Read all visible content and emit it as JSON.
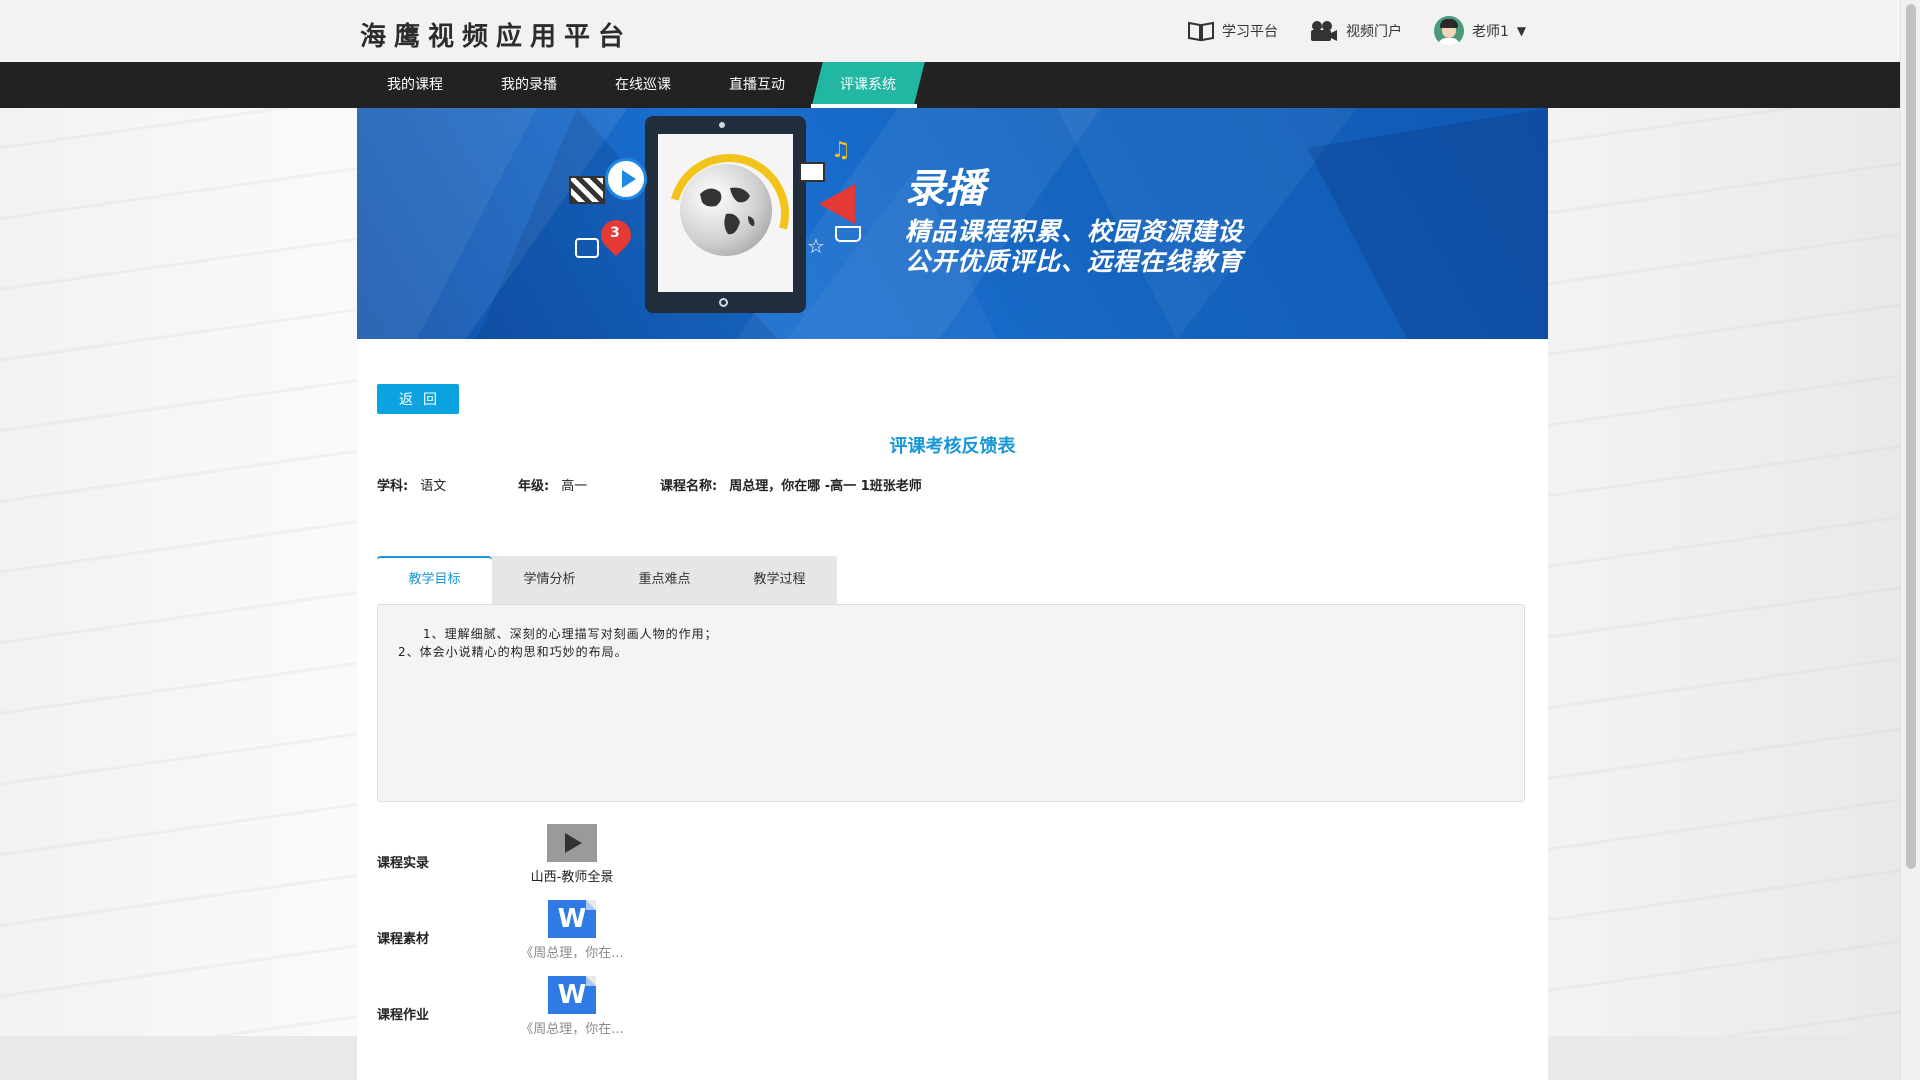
{
  "header": {
    "platform_title": "海鹰视频应用平台",
    "links": {
      "study_platform": "学习平台",
      "video_portal": "视频门户",
      "user_name": "老师1",
      "dropdown_glyph": "▼"
    },
    "icons": [
      "book-icon",
      "video-camera-icon",
      "avatar",
      "caret-down-icon"
    ]
  },
  "nav": {
    "items": [
      "我的课程",
      "我的录播",
      "在线巡课",
      "直播互动",
      "评课系统"
    ],
    "active": "评课系统",
    "active_color": "#21b7a2"
  },
  "banner": {
    "heading": "录播",
    "line1": "精品课程积累、校园资源建设",
    "line2": "公开优质评比、远程在线教育",
    "badge_number": "3",
    "background_color": "#1565c0"
  },
  "main": {
    "back_button": "返回",
    "form_title": "评课考核反馈表",
    "meta": {
      "subject_label": "学科:",
      "subject_value": "语文",
      "grade_label": "年级:",
      "grade_value": "高一",
      "course_label": "课程名称:",
      "course_value": "周总理，你在哪 -高一 1班张老师"
    },
    "tabs": [
      "教学目标",
      "学情分析",
      "重点难点",
      "教学过程"
    ],
    "active_tab": "教学目标",
    "tab_content": {
      "line1": "1、理解细腻、深刻的心理描写对刻画人物的作用；",
      "line2": "2、体会小说精心的构思和巧妙的布局。"
    },
    "resources": {
      "recording_label": "课程实录",
      "recording_item": "山西-教师全景",
      "material_label": "课程素材",
      "material_item": "《周总理，你在...",
      "homework_label": "课程作业",
      "homework_item": "《周总理，你在..."
    },
    "accent_color": "#1798d6",
    "button_color": "#0aa3e0"
  }
}
